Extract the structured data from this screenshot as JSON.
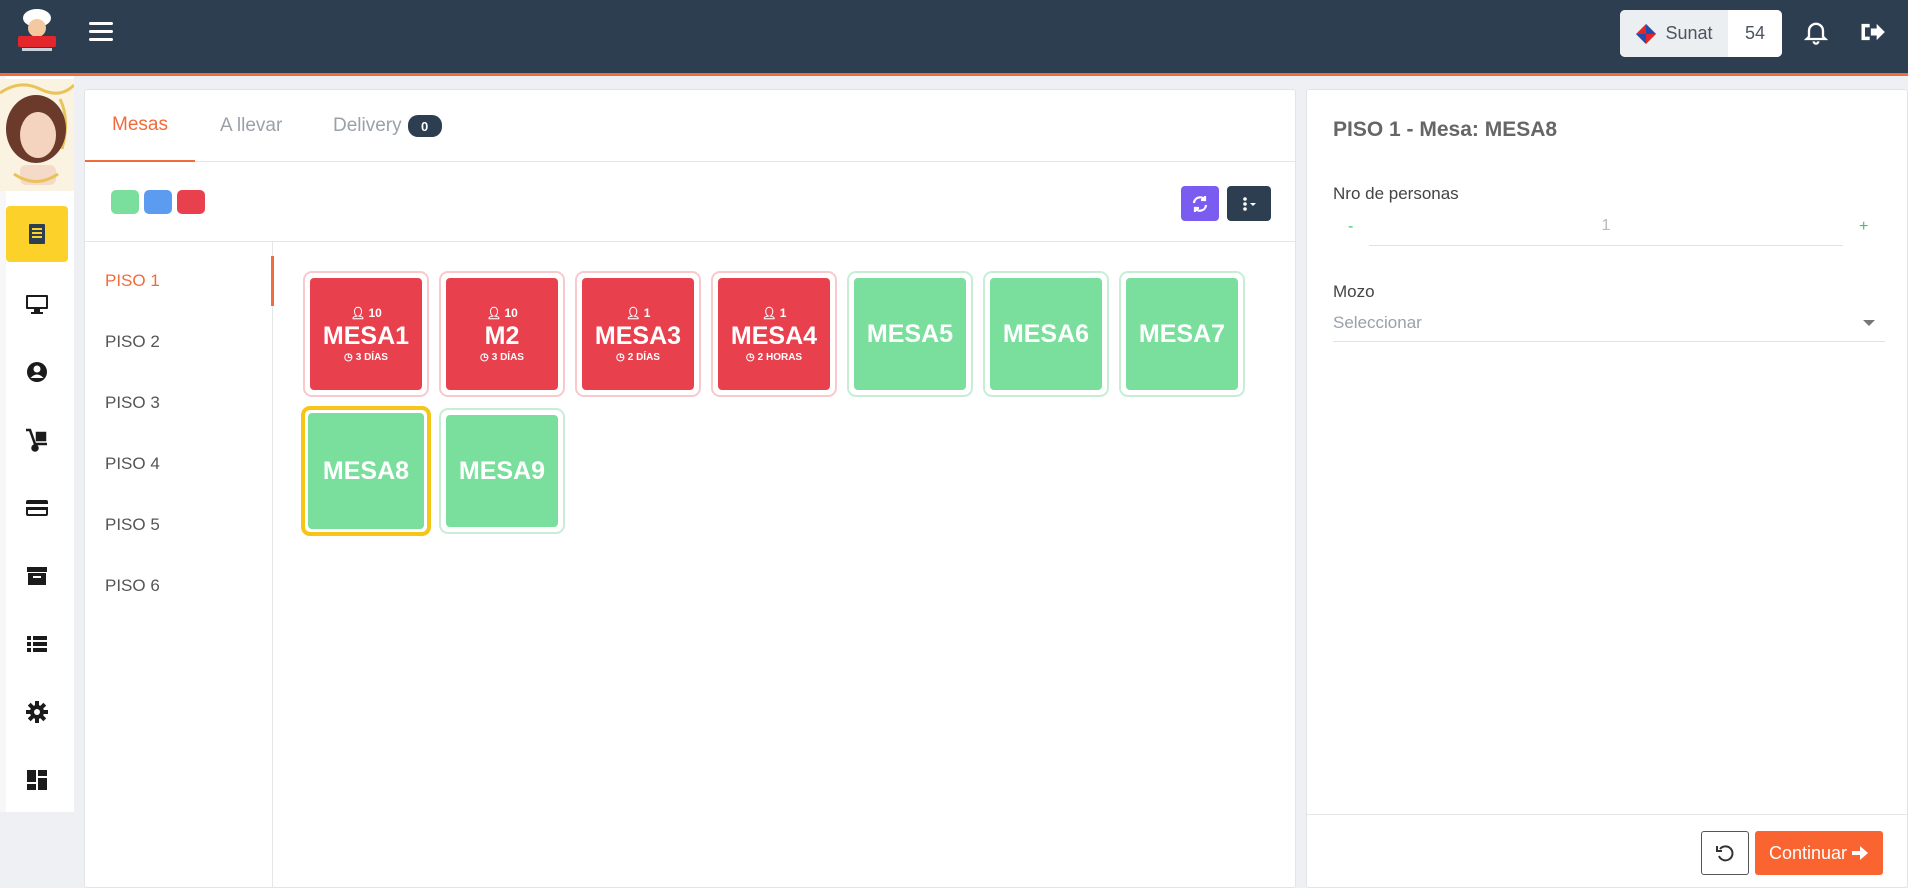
{
  "topbar": {
    "menu_icon": "hamburger-icon",
    "sunat_label": "Sunat",
    "sunat_count": "54",
    "bell_icon": "bell-icon",
    "logout_icon": "logout-icon"
  },
  "sidenav": {
    "items": [
      {
        "icon": "receipt-icon",
        "active": true
      },
      {
        "icon": "monitor-icon"
      },
      {
        "icon": "user-circle-icon"
      },
      {
        "icon": "dolly-icon"
      },
      {
        "icon": "credit-card-icon"
      },
      {
        "icon": "archive-icon"
      },
      {
        "icon": "list-icon"
      },
      {
        "icon": "gear-icon"
      },
      {
        "icon": "dashboard-icon"
      }
    ]
  },
  "tabs": [
    {
      "label": "Mesas",
      "active": true
    },
    {
      "label": "A llevar"
    },
    {
      "label": "Delivery",
      "badge": "0"
    }
  ],
  "legend_colors": [
    "#7adf9d",
    "#5b9cf0",
    "#e9404e"
  ],
  "floors": [
    "PISO 1",
    "PISO 2",
    "PISO 3",
    "PISO 4",
    "PISO 5",
    "PISO 6"
  ],
  "tables": [
    {
      "name": "MESA1",
      "people": "10",
      "time": "3 DÍAS",
      "status": "busy"
    },
    {
      "name": "M2",
      "people": "10",
      "time": "3 DÍAS",
      "status": "busy"
    },
    {
      "name": "MESA3",
      "people": "1",
      "time": "2 DÍAS",
      "status": "busy"
    },
    {
      "name": "MESA4",
      "people": "1",
      "time": "2 HORAS",
      "status": "busy"
    },
    {
      "name": "MESA5",
      "status": "free"
    },
    {
      "name": "MESA6",
      "status": "free"
    },
    {
      "name": "MESA7",
      "status": "free"
    },
    {
      "name": "MESA8",
      "status": "selected"
    },
    {
      "name": "MESA9",
      "status": "free"
    }
  ],
  "panel": {
    "title": "PISO 1 - Mesa: MESA8",
    "persons_label": "Nro de personas",
    "minus": "-",
    "plus": "+",
    "persons_value": "1",
    "waiter_label": "Mozo",
    "waiter_placeholder": "Seleccionar",
    "continue_label": "Continuar"
  },
  "colors": {
    "accent": "#f26b3a",
    "topbar": "#2d3e50",
    "busy": "#e9404e",
    "free": "#7adf9d",
    "selected_border": "#f5c518",
    "refresh_button": "#7b5cf0"
  }
}
